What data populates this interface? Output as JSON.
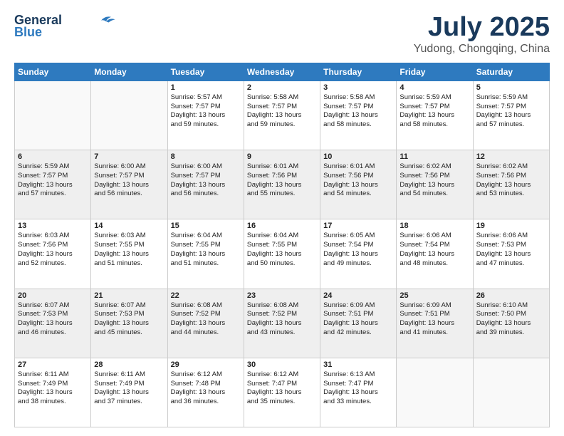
{
  "header": {
    "logo_line1": "General",
    "logo_line2": "Blue",
    "title": "July 2025",
    "location": "Yudong, Chongqing, China"
  },
  "weekdays": [
    "Sunday",
    "Monday",
    "Tuesday",
    "Wednesday",
    "Thursday",
    "Friday",
    "Saturday"
  ],
  "weeks": [
    [
      {
        "day": "",
        "info": ""
      },
      {
        "day": "",
        "info": ""
      },
      {
        "day": "1",
        "info": "Sunrise: 5:57 AM\nSunset: 7:57 PM\nDaylight: 13 hours\nand 59 minutes."
      },
      {
        "day": "2",
        "info": "Sunrise: 5:58 AM\nSunset: 7:57 PM\nDaylight: 13 hours\nand 59 minutes."
      },
      {
        "day": "3",
        "info": "Sunrise: 5:58 AM\nSunset: 7:57 PM\nDaylight: 13 hours\nand 58 minutes."
      },
      {
        "day": "4",
        "info": "Sunrise: 5:59 AM\nSunset: 7:57 PM\nDaylight: 13 hours\nand 58 minutes."
      },
      {
        "day": "5",
        "info": "Sunrise: 5:59 AM\nSunset: 7:57 PM\nDaylight: 13 hours\nand 57 minutes."
      }
    ],
    [
      {
        "day": "6",
        "info": "Sunrise: 5:59 AM\nSunset: 7:57 PM\nDaylight: 13 hours\nand 57 minutes."
      },
      {
        "day": "7",
        "info": "Sunrise: 6:00 AM\nSunset: 7:57 PM\nDaylight: 13 hours\nand 56 minutes."
      },
      {
        "day": "8",
        "info": "Sunrise: 6:00 AM\nSunset: 7:57 PM\nDaylight: 13 hours\nand 56 minutes."
      },
      {
        "day": "9",
        "info": "Sunrise: 6:01 AM\nSunset: 7:56 PM\nDaylight: 13 hours\nand 55 minutes."
      },
      {
        "day": "10",
        "info": "Sunrise: 6:01 AM\nSunset: 7:56 PM\nDaylight: 13 hours\nand 54 minutes."
      },
      {
        "day": "11",
        "info": "Sunrise: 6:02 AM\nSunset: 7:56 PM\nDaylight: 13 hours\nand 54 minutes."
      },
      {
        "day": "12",
        "info": "Sunrise: 6:02 AM\nSunset: 7:56 PM\nDaylight: 13 hours\nand 53 minutes."
      }
    ],
    [
      {
        "day": "13",
        "info": "Sunrise: 6:03 AM\nSunset: 7:56 PM\nDaylight: 13 hours\nand 52 minutes."
      },
      {
        "day": "14",
        "info": "Sunrise: 6:03 AM\nSunset: 7:55 PM\nDaylight: 13 hours\nand 51 minutes."
      },
      {
        "day": "15",
        "info": "Sunrise: 6:04 AM\nSunset: 7:55 PM\nDaylight: 13 hours\nand 51 minutes."
      },
      {
        "day": "16",
        "info": "Sunrise: 6:04 AM\nSunset: 7:55 PM\nDaylight: 13 hours\nand 50 minutes."
      },
      {
        "day": "17",
        "info": "Sunrise: 6:05 AM\nSunset: 7:54 PM\nDaylight: 13 hours\nand 49 minutes."
      },
      {
        "day": "18",
        "info": "Sunrise: 6:06 AM\nSunset: 7:54 PM\nDaylight: 13 hours\nand 48 minutes."
      },
      {
        "day": "19",
        "info": "Sunrise: 6:06 AM\nSunset: 7:53 PM\nDaylight: 13 hours\nand 47 minutes."
      }
    ],
    [
      {
        "day": "20",
        "info": "Sunrise: 6:07 AM\nSunset: 7:53 PM\nDaylight: 13 hours\nand 46 minutes."
      },
      {
        "day": "21",
        "info": "Sunrise: 6:07 AM\nSunset: 7:53 PM\nDaylight: 13 hours\nand 45 minutes."
      },
      {
        "day": "22",
        "info": "Sunrise: 6:08 AM\nSunset: 7:52 PM\nDaylight: 13 hours\nand 44 minutes."
      },
      {
        "day": "23",
        "info": "Sunrise: 6:08 AM\nSunset: 7:52 PM\nDaylight: 13 hours\nand 43 minutes."
      },
      {
        "day": "24",
        "info": "Sunrise: 6:09 AM\nSunset: 7:51 PM\nDaylight: 13 hours\nand 42 minutes."
      },
      {
        "day": "25",
        "info": "Sunrise: 6:09 AM\nSunset: 7:51 PM\nDaylight: 13 hours\nand 41 minutes."
      },
      {
        "day": "26",
        "info": "Sunrise: 6:10 AM\nSunset: 7:50 PM\nDaylight: 13 hours\nand 39 minutes."
      }
    ],
    [
      {
        "day": "27",
        "info": "Sunrise: 6:11 AM\nSunset: 7:49 PM\nDaylight: 13 hours\nand 38 minutes."
      },
      {
        "day": "28",
        "info": "Sunrise: 6:11 AM\nSunset: 7:49 PM\nDaylight: 13 hours\nand 37 minutes."
      },
      {
        "day": "29",
        "info": "Sunrise: 6:12 AM\nSunset: 7:48 PM\nDaylight: 13 hours\nand 36 minutes."
      },
      {
        "day": "30",
        "info": "Sunrise: 6:12 AM\nSunset: 7:47 PM\nDaylight: 13 hours\nand 35 minutes."
      },
      {
        "day": "31",
        "info": "Sunrise: 6:13 AM\nSunset: 7:47 PM\nDaylight: 13 hours\nand 33 minutes."
      },
      {
        "day": "",
        "info": ""
      },
      {
        "day": "",
        "info": ""
      }
    ]
  ]
}
